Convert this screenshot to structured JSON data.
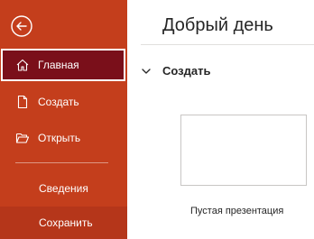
{
  "colors": {
    "sidebar_bg": "#c43e1c",
    "active_bg": "#7a0f1a",
    "save_bg": "#b5361a"
  },
  "sidebar": {
    "back_icon": "back-arrow-circle-icon",
    "items": [
      {
        "label": "Главная",
        "icon": "home-icon",
        "active": true
      },
      {
        "label": "Создать",
        "icon": "new-document-icon"
      },
      {
        "label": "Открыть",
        "icon": "folder-open-icon"
      },
      {
        "label": "Сведения"
      },
      {
        "label": "Сохранить"
      }
    ]
  },
  "main": {
    "greeting": "Добрый день",
    "section_title": "Создать",
    "templates": [
      {
        "label": "Пустая презентация"
      }
    ]
  }
}
